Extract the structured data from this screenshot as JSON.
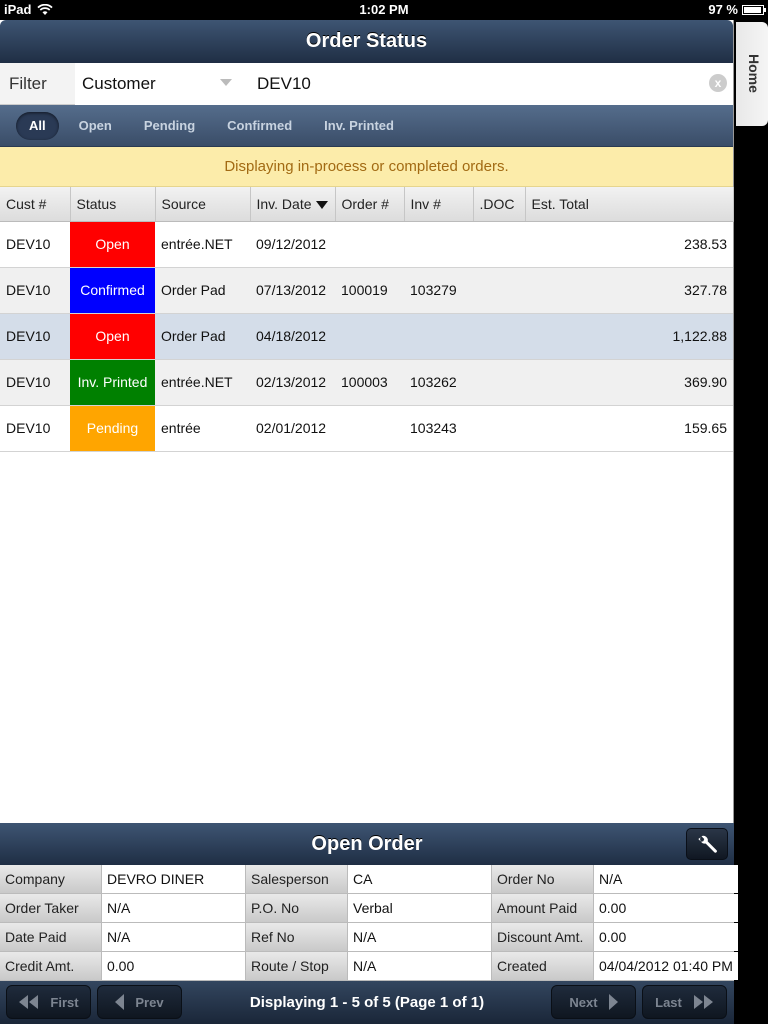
{
  "statusbar": {
    "device": "iPad",
    "time": "1:02 PM",
    "battery": "97 %",
    "battery_level": 0.97
  },
  "header": {
    "title": "Order Status"
  },
  "home_tab": {
    "label": "Home"
  },
  "filter": {
    "label": "Filter",
    "field": "Customer",
    "value": "DEV10",
    "clear_label": "x"
  },
  "segments": [
    {
      "label": "All",
      "active": true
    },
    {
      "label": "Open"
    },
    {
      "label": "Pending"
    },
    {
      "label": "Confirmed"
    },
    {
      "label": "Inv. Printed"
    }
  ],
  "banner": {
    "text": "Displaying in-process or completed orders."
  },
  "table": {
    "columns": [
      "Cust #",
      "Status",
      "Source",
      "Inv. Date",
      "Order #",
      "Inv #",
      ".DOC",
      "Est. Total"
    ],
    "sort_column": "Inv. Date",
    "rows": [
      {
        "cust": "DEV10",
        "status": "Open",
        "status_color": "#ff0000",
        "source": "entrée.NET",
        "inv_date": "09/12/2012",
        "order": "",
        "inv": "",
        "doc": "",
        "total": "238.53"
      },
      {
        "cust": "DEV10",
        "status": "Confirmed",
        "status_color": "#0000ff",
        "source": "Order Pad",
        "inv_date": "07/13/2012",
        "order": "100019",
        "inv": "103279",
        "doc": "",
        "total": "327.78"
      },
      {
        "cust": "DEV10",
        "status": "Open",
        "status_color": "#ff0000",
        "source": "Order Pad",
        "inv_date": "04/18/2012",
        "order": "",
        "inv": "",
        "doc": "",
        "total": "1,122.88",
        "selected": true
      },
      {
        "cust": "DEV10",
        "status": "Inv. Printed",
        "status_color": "#008000",
        "source": "entrée.NET",
        "inv_date": "02/13/2012",
        "order": "100003",
        "inv": "103262",
        "doc": "",
        "total": "369.90"
      },
      {
        "cust": "DEV10",
        "status": "Pending",
        "status_color": "#ffa500",
        "source": "entrée",
        "inv_date": "02/01/2012",
        "order": "",
        "inv": "103243",
        "doc": "",
        "total": "159.65"
      }
    ]
  },
  "detail": {
    "title": "Open Order",
    "rows": [
      [
        [
          "Company",
          "DEVRO DINER"
        ],
        [
          "Salesperson",
          "CA"
        ],
        [
          "Order No",
          "N/A"
        ]
      ],
      [
        [
          "Order Taker",
          "N/A"
        ],
        [
          "P.O. No",
          "Verbal"
        ],
        [
          "Amount Paid",
          "0.00"
        ]
      ],
      [
        [
          "Date Paid",
          "N/A"
        ],
        [
          "Ref No",
          "N/A"
        ],
        [
          "Discount Amt.",
          "0.00"
        ]
      ],
      [
        [
          "Credit Amt.",
          "0.00"
        ],
        [
          "Route / Stop",
          "N/A"
        ],
        [
          "Created",
          "04/04/2012 01:40 PM"
        ]
      ]
    ]
  },
  "pager": {
    "first": "First",
    "prev": "Prev",
    "next": "Next",
    "last": "Last",
    "text": "Displaying 1 - 5 of 5 (Page 1 of 1)"
  }
}
